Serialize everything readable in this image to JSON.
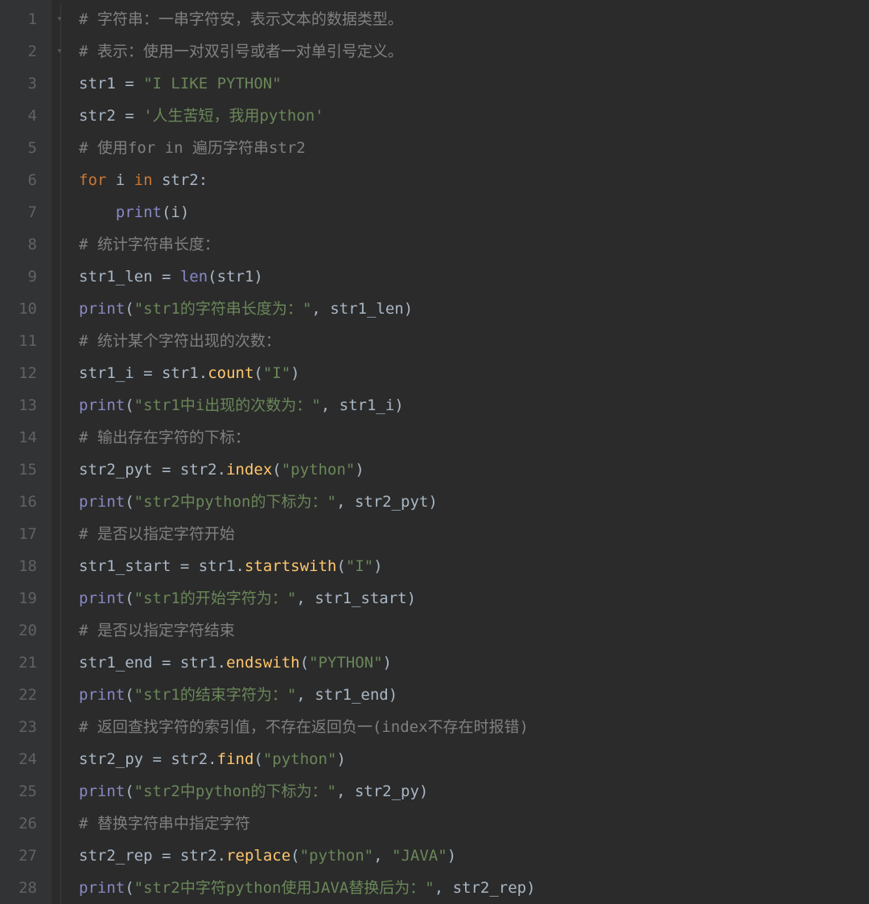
{
  "lines": [
    {
      "num": 1,
      "fold": true,
      "indent": 0,
      "tokens": [
        {
          "t": "# 字符串：一串字符安，表示文本的数据类型。",
          "c": "c-comment"
        }
      ]
    },
    {
      "num": 2,
      "fold": true,
      "indent": 0,
      "tokens": [
        {
          "t": "# 表示：使用一对双引号或者一对单引号定义。",
          "c": "c-comment"
        }
      ]
    },
    {
      "num": 3,
      "indent": 0,
      "tokens": [
        {
          "t": "str1 ",
          "c": "c-ident"
        },
        {
          "t": "= ",
          "c": "c-op"
        },
        {
          "t": "\"I LIKE PYTHON\"",
          "c": "c-string"
        }
      ]
    },
    {
      "num": 4,
      "indent": 0,
      "tokens": [
        {
          "t": "str2 ",
          "c": "c-ident"
        },
        {
          "t": "= ",
          "c": "c-op"
        },
        {
          "t": "'人生苦短，我用python'",
          "c": "c-string"
        }
      ]
    },
    {
      "num": 5,
      "indent": 0,
      "tokens": [
        {
          "t": "# 使用for in 遍历字符串str2",
          "c": "c-comment"
        }
      ]
    },
    {
      "num": 6,
      "indent": 0,
      "tokens": [
        {
          "t": "for ",
          "c": "c-keyword"
        },
        {
          "t": "i ",
          "c": "c-ident"
        },
        {
          "t": "in ",
          "c": "c-keyword"
        },
        {
          "t": "str2",
          "c": "c-ident"
        },
        {
          "t": ":",
          "c": "c-punc"
        }
      ]
    },
    {
      "num": 7,
      "indent": 1,
      "tokens": [
        {
          "t": "print",
          "c": "c-builtin"
        },
        {
          "t": "(",
          "c": "c-punc"
        },
        {
          "t": "i",
          "c": "c-ident"
        },
        {
          "t": ")",
          "c": "c-punc"
        }
      ]
    },
    {
      "num": 8,
      "indent": 0,
      "tokens": [
        {
          "t": "# 统计字符串长度：",
          "c": "c-comment"
        }
      ]
    },
    {
      "num": 9,
      "indent": 0,
      "tokens": [
        {
          "t": "str1_len ",
          "c": "c-ident"
        },
        {
          "t": "= ",
          "c": "c-op"
        },
        {
          "t": "len",
          "c": "c-builtin"
        },
        {
          "t": "(",
          "c": "c-punc"
        },
        {
          "t": "str1",
          "c": "c-ident"
        },
        {
          "t": ")",
          "c": "c-punc"
        }
      ]
    },
    {
      "num": 10,
      "indent": 0,
      "tokens": [
        {
          "t": "print",
          "c": "c-builtin"
        },
        {
          "t": "(",
          "c": "c-punc"
        },
        {
          "t": "\"str1的字符串长度为：\"",
          "c": "c-string"
        },
        {
          "t": ", ",
          "c": "c-punc"
        },
        {
          "t": "str1_len",
          "c": "c-ident"
        },
        {
          "t": ")",
          "c": "c-punc"
        }
      ]
    },
    {
      "num": 11,
      "indent": 0,
      "tokens": [
        {
          "t": "# 统计某个字符出现的次数：",
          "c": "c-comment"
        }
      ]
    },
    {
      "num": 12,
      "indent": 0,
      "tokens": [
        {
          "t": "str1_i ",
          "c": "c-ident"
        },
        {
          "t": "= ",
          "c": "c-op"
        },
        {
          "t": "str1",
          "c": "c-ident"
        },
        {
          "t": ".",
          "c": "c-punc"
        },
        {
          "t": "count",
          "c": "c-func"
        },
        {
          "t": "(",
          "c": "c-punc"
        },
        {
          "t": "\"I\"",
          "c": "c-string"
        },
        {
          "t": ")",
          "c": "c-punc"
        }
      ]
    },
    {
      "num": 13,
      "indent": 0,
      "tokens": [
        {
          "t": "print",
          "c": "c-builtin"
        },
        {
          "t": "(",
          "c": "c-punc"
        },
        {
          "t": "\"str1中i出现的次数为：\"",
          "c": "c-string"
        },
        {
          "t": ", ",
          "c": "c-punc"
        },
        {
          "t": "str1_i",
          "c": "c-ident"
        },
        {
          "t": ")",
          "c": "c-punc"
        }
      ]
    },
    {
      "num": 14,
      "indent": 0,
      "tokens": [
        {
          "t": "# 输出存在字符的下标：",
          "c": "c-comment"
        }
      ]
    },
    {
      "num": 15,
      "indent": 0,
      "tokens": [
        {
          "t": "str2_pyt ",
          "c": "c-ident"
        },
        {
          "t": "= ",
          "c": "c-op"
        },
        {
          "t": "str2",
          "c": "c-ident"
        },
        {
          "t": ".",
          "c": "c-punc"
        },
        {
          "t": "index",
          "c": "c-func"
        },
        {
          "t": "(",
          "c": "c-punc"
        },
        {
          "t": "\"python\"",
          "c": "c-string"
        },
        {
          "t": ")",
          "c": "c-punc"
        }
      ]
    },
    {
      "num": 16,
      "indent": 0,
      "tokens": [
        {
          "t": "print",
          "c": "c-builtin"
        },
        {
          "t": "(",
          "c": "c-punc"
        },
        {
          "t": "\"str2中python的下标为：\"",
          "c": "c-string"
        },
        {
          "t": ", ",
          "c": "c-punc"
        },
        {
          "t": "str2_pyt",
          "c": "c-ident"
        },
        {
          "t": ")",
          "c": "c-punc"
        }
      ]
    },
    {
      "num": 17,
      "indent": 0,
      "tokens": [
        {
          "t": "# 是否以指定字符开始",
          "c": "c-comment"
        }
      ]
    },
    {
      "num": 18,
      "indent": 0,
      "tokens": [
        {
          "t": "str1_start ",
          "c": "c-ident"
        },
        {
          "t": "= ",
          "c": "c-op"
        },
        {
          "t": "str1",
          "c": "c-ident"
        },
        {
          "t": ".",
          "c": "c-punc"
        },
        {
          "t": "startswith",
          "c": "c-func"
        },
        {
          "t": "(",
          "c": "c-punc"
        },
        {
          "t": "\"I\"",
          "c": "c-string"
        },
        {
          "t": ")",
          "c": "c-punc"
        }
      ]
    },
    {
      "num": 19,
      "indent": 0,
      "tokens": [
        {
          "t": "print",
          "c": "c-builtin"
        },
        {
          "t": "(",
          "c": "c-punc"
        },
        {
          "t": "\"str1的开始字符为：\"",
          "c": "c-string"
        },
        {
          "t": ", ",
          "c": "c-punc"
        },
        {
          "t": "str1_start",
          "c": "c-ident"
        },
        {
          "t": ")",
          "c": "c-punc"
        }
      ]
    },
    {
      "num": 20,
      "indent": 0,
      "tokens": [
        {
          "t": "# 是否以指定字符结束",
          "c": "c-comment"
        }
      ]
    },
    {
      "num": 21,
      "indent": 0,
      "tokens": [
        {
          "t": "str1_end ",
          "c": "c-ident"
        },
        {
          "t": "= ",
          "c": "c-op"
        },
        {
          "t": "str1",
          "c": "c-ident"
        },
        {
          "t": ".",
          "c": "c-punc"
        },
        {
          "t": "endswith",
          "c": "c-func"
        },
        {
          "t": "(",
          "c": "c-punc"
        },
        {
          "t": "\"PYTHON\"",
          "c": "c-string"
        },
        {
          "t": ")",
          "c": "c-punc"
        }
      ]
    },
    {
      "num": 22,
      "indent": 0,
      "tokens": [
        {
          "t": "print",
          "c": "c-builtin"
        },
        {
          "t": "(",
          "c": "c-punc"
        },
        {
          "t": "\"str1的结束字符为：\"",
          "c": "c-string"
        },
        {
          "t": ", ",
          "c": "c-punc"
        },
        {
          "t": "str1_end",
          "c": "c-ident"
        },
        {
          "t": ")",
          "c": "c-punc"
        }
      ]
    },
    {
      "num": 23,
      "indent": 0,
      "tokens": [
        {
          "t": "# 返回查找字符的索引值，不存在返回负一(index不存在时报错)",
          "c": "c-comment"
        }
      ]
    },
    {
      "num": 24,
      "indent": 0,
      "tokens": [
        {
          "t": "str2_py ",
          "c": "c-ident"
        },
        {
          "t": "= ",
          "c": "c-op"
        },
        {
          "t": "str2",
          "c": "c-ident"
        },
        {
          "t": ".",
          "c": "c-punc"
        },
        {
          "t": "find",
          "c": "c-func"
        },
        {
          "t": "(",
          "c": "c-punc"
        },
        {
          "t": "\"python\"",
          "c": "c-string"
        },
        {
          "t": ")",
          "c": "c-punc"
        }
      ]
    },
    {
      "num": 25,
      "indent": 0,
      "tokens": [
        {
          "t": "print",
          "c": "c-builtin"
        },
        {
          "t": "(",
          "c": "c-punc"
        },
        {
          "t": "\"str2中python的下标为：\"",
          "c": "c-string"
        },
        {
          "t": ", ",
          "c": "c-punc"
        },
        {
          "t": "str2_py",
          "c": "c-ident"
        },
        {
          "t": ")",
          "c": "c-punc"
        }
      ]
    },
    {
      "num": 26,
      "indent": 0,
      "tokens": [
        {
          "t": "# 替换字符串中指定字符",
          "c": "c-comment"
        }
      ]
    },
    {
      "num": 27,
      "indent": 0,
      "tokens": [
        {
          "t": "str2_rep ",
          "c": "c-ident"
        },
        {
          "t": "= ",
          "c": "c-op"
        },
        {
          "t": "str2",
          "c": "c-ident"
        },
        {
          "t": ".",
          "c": "c-punc"
        },
        {
          "t": "replace",
          "c": "c-func"
        },
        {
          "t": "(",
          "c": "c-punc"
        },
        {
          "t": "\"python\"",
          "c": "c-string"
        },
        {
          "t": ", ",
          "c": "c-punc"
        },
        {
          "t": "\"JAVA\"",
          "c": "c-string"
        },
        {
          "t": ")",
          "c": "c-punc"
        }
      ]
    },
    {
      "num": 28,
      "indent": 0,
      "tokens": [
        {
          "t": "print",
          "c": "c-builtin"
        },
        {
          "t": "(",
          "c": "c-punc"
        },
        {
          "t": "\"str2中字符python使用JAVA替换后为：\"",
          "c": "c-string"
        },
        {
          "t": ", ",
          "c": "c-punc"
        },
        {
          "t": "str2_rep",
          "c": "c-ident"
        },
        {
          "t": ")",
          "c": "c-punc"
        }
      ]
    }
  ]
}
